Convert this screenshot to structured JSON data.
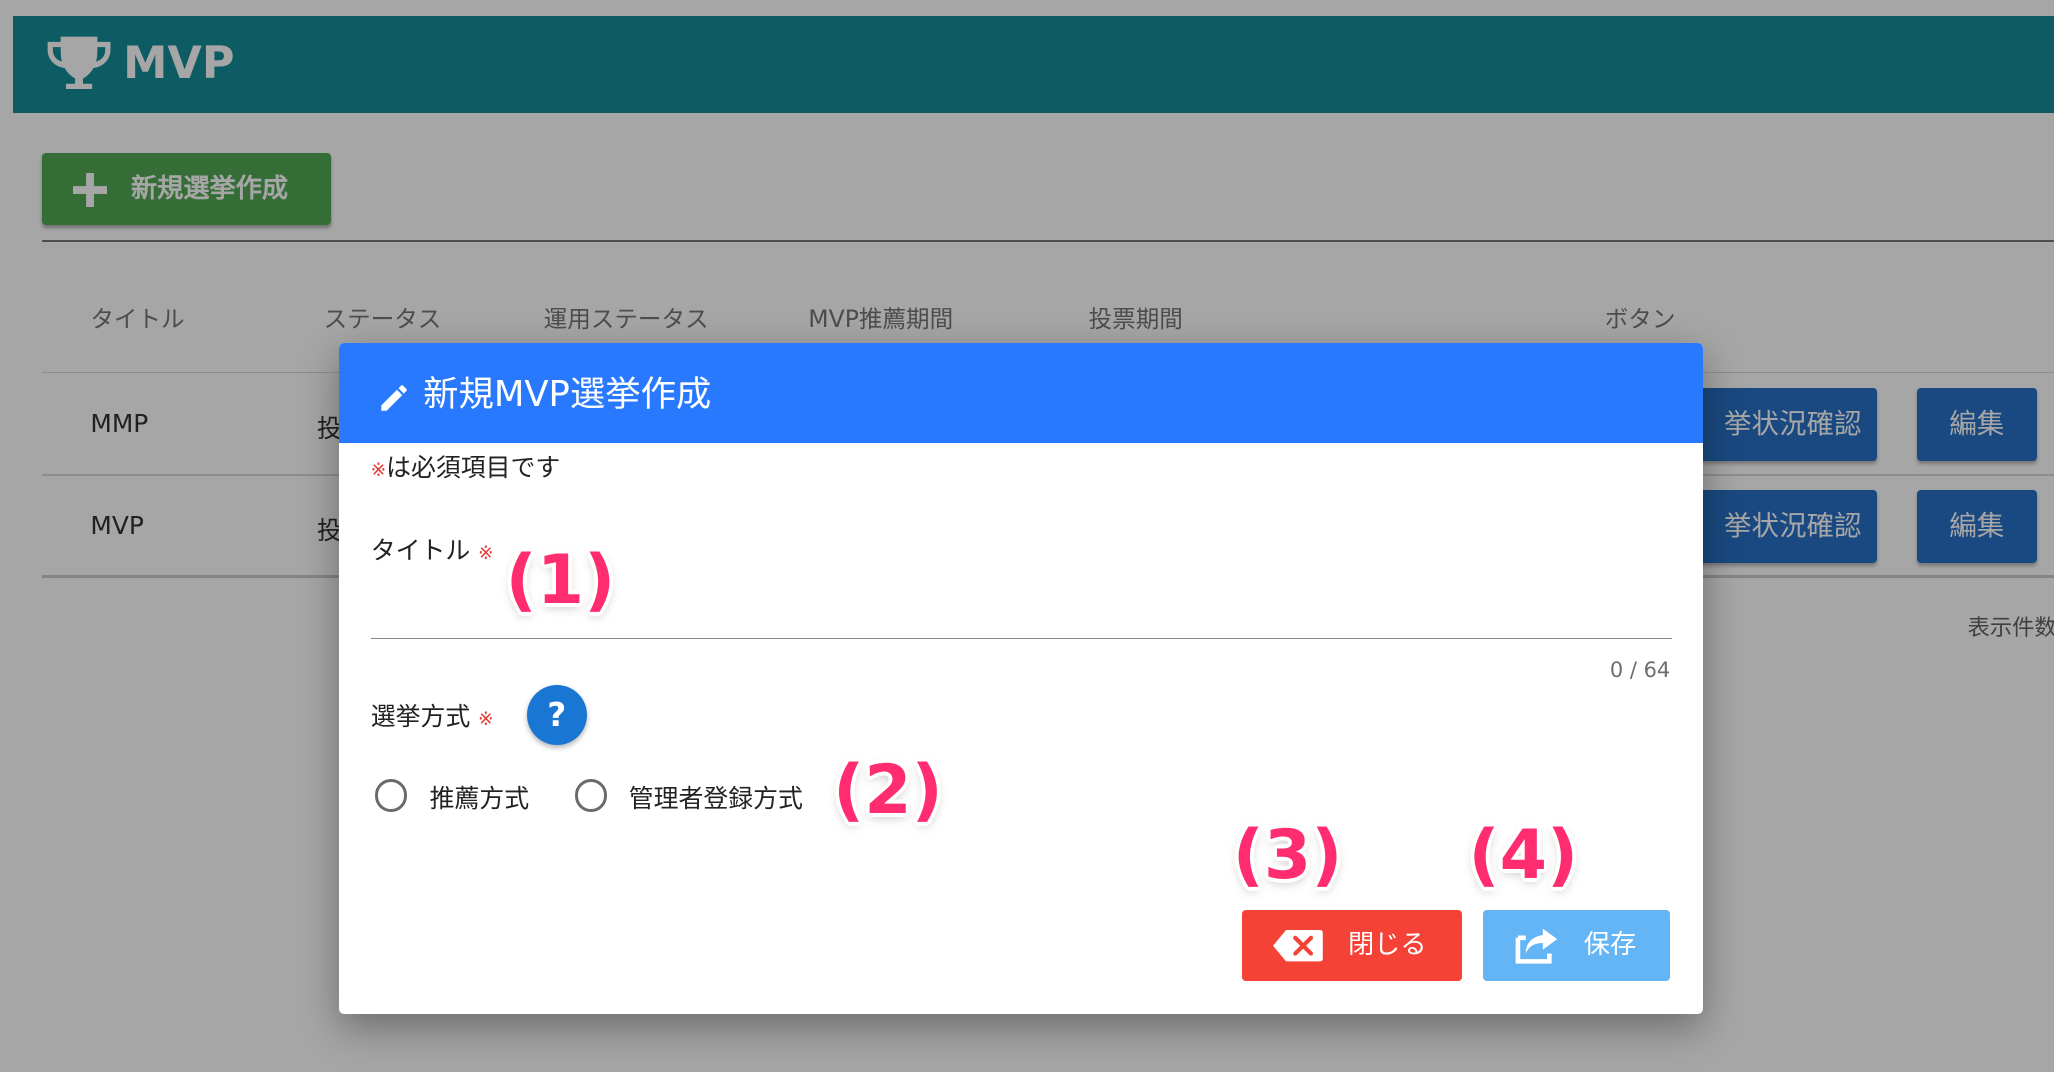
{
  "app": {
    "title": "MVP"
  },
  "toolbar": {
    "new_election_label": "新規選挙作成"
  },
  "table": {
    "columns": [
      "タイトル",
      "ステータス",
      "運用ステータス",
      "MVP推薦期間",
      "投票期間",
      "ボタン"
    ],
    "rows": [
      {
        "title": "MMP",
        "status": "投",
        "status_button": "挙状況確認",
        "edit_button": "編集"
      },
      {
        "title": "MVP",
        "status": "投",
        "status_button": "挙状況確認",
        "edit_button": "編集"
      }
    ],
    "per_page_label": "表示件数"
  },
  "dialog": {
    "title": "新規MVP選挙作成",
    "required_mark": "※",
    "required_note": "は必須項目です",
    "title_field": {
      "label": "タイトル",
      "value": "",
      "counter": "0 / 64"
    },
    "method_field": {
      "label": "選挙方式",
      "help_label": "?",
      "options": [
        "推薦方式",
        "管理者登録方式"
      ],
      "selected": null
    },
    "close_label": "閉じる",
    "save_label": "保存"
  },
  "annotations": [
    "(1)",
    "(2)",
    "(3)",
    "(4)"
  ],
  "colors": {
    "app_bar": "#00838f",
    "new_button": "#43a047",
    "dialog_header": "#2979ff",
    "close_button": "#f44336",
    "save_button": "#64b5f6",
    "callout": "#ff2d6f"
  }
}
